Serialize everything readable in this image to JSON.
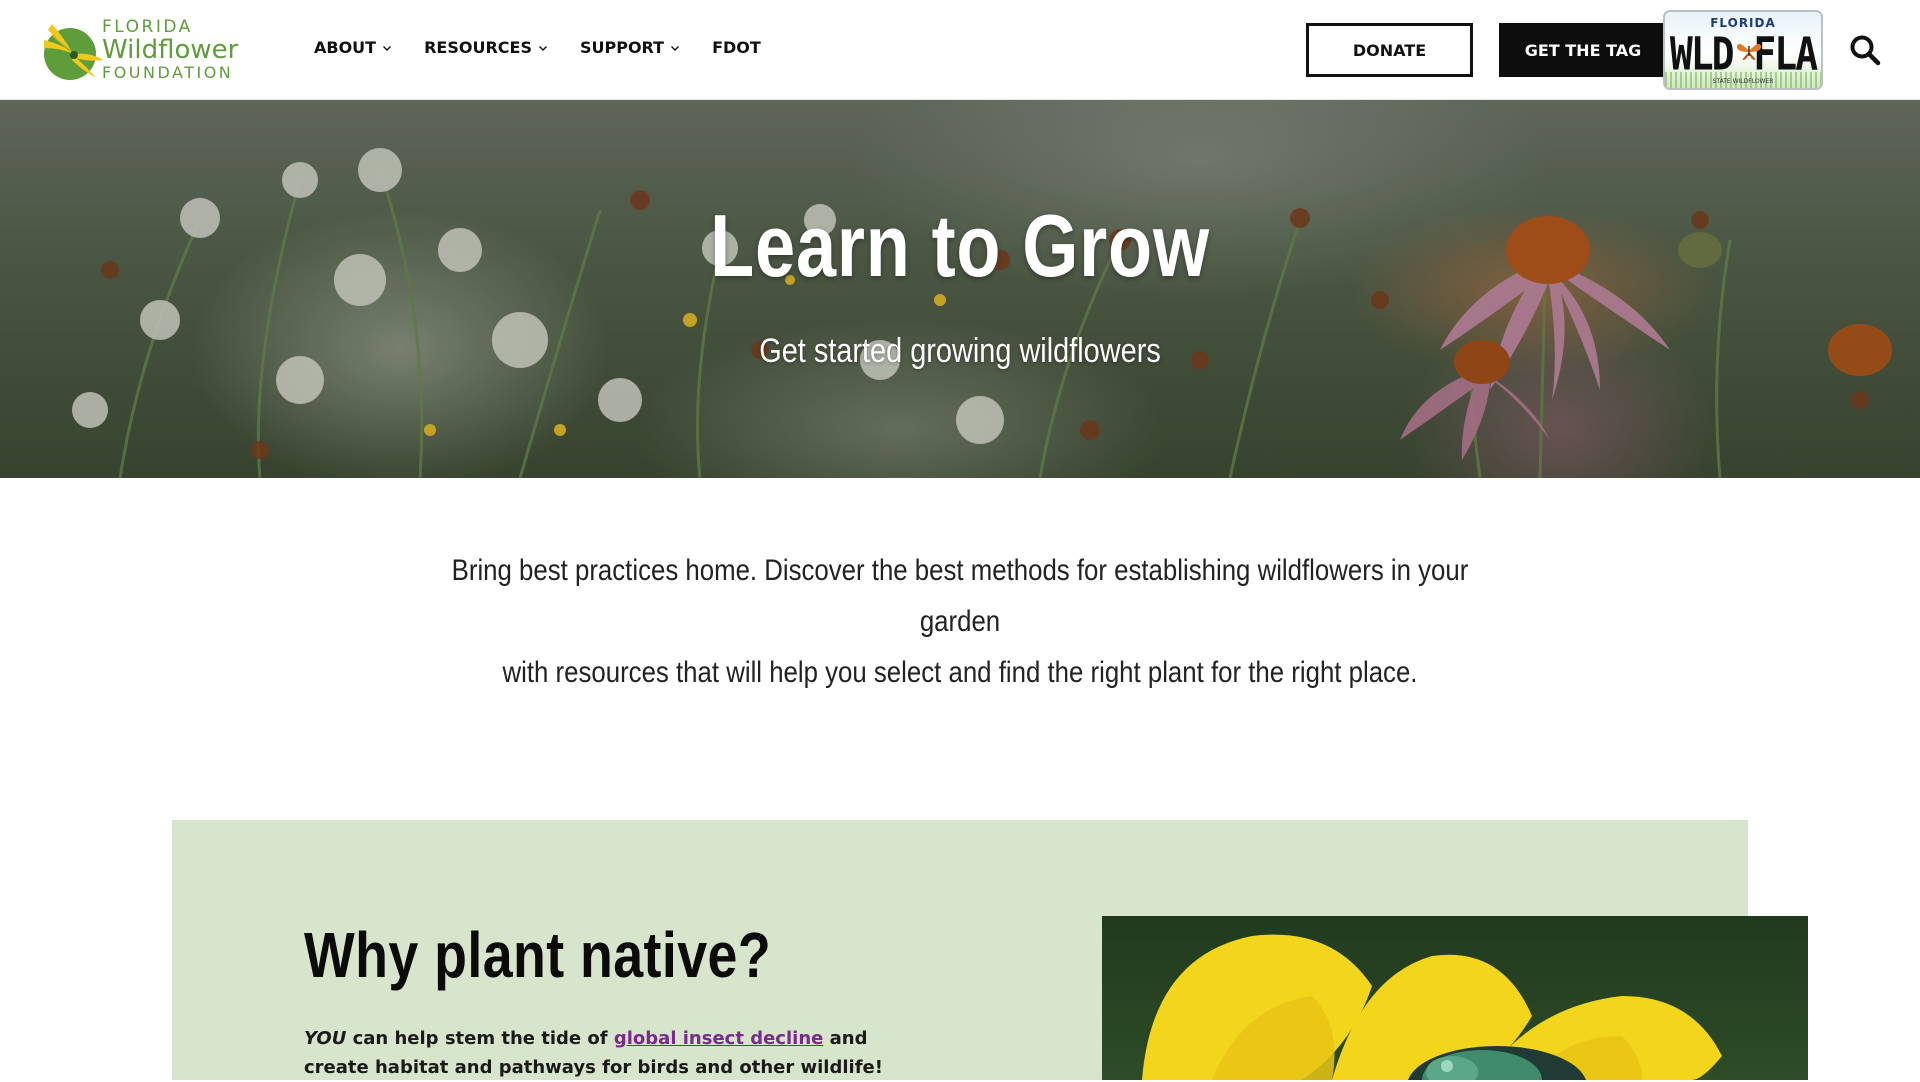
{
  "brand": {
    "line1": "FLORIDA",
    "line2": "Wildflower",
    "line3": "FOUNDATION",
    "color": "#5f9c3a"
  },
  "nav": {
    "items": [
      {
        "label": "ABOUT",
        "has_dropdown": true
      },
      {
        "label": "RESOURCES",
        "has_dropdown": true
      },
      {
        "label": "SUPPORT",
        "has_dropdown": true
      },
      {
        "label": "FDOT",
        "has_dropdown": false
      }
    ]
  },
  "header_actions": {
    "donate_label": "DONATE",
    "tag_label": "GET THE TAG",
    "plate": {
      "state": "FLORIDA",
      "number": "WLD FLA",
      "caption": "STATE WILDFLOWER"
    },
    "search_icon": "search-icon"
  },
  "hero": {
    "title": "Learn to Grow",
    "subtitle": "Get started growing wildflowers"
  },
  "intro": {
    "line1": "Bring best practices home. Discover the best methods for establishing wildflowers in your garden",
    "line2": "with resources that will help you select and find the right plant for the right place."
  },
  "why": {
    "title": "Why plant native?",
    "emphasis": "YOU",
    "text_before_link": " can help stem the tide of ",
    "link_text": "global insect decline",
    "text_after_link": " and create habitat and pathways for birds and other wildlife!",
    "background": "#d8e5cd",
    "link_color": "#7a2a8c"
  }
}
